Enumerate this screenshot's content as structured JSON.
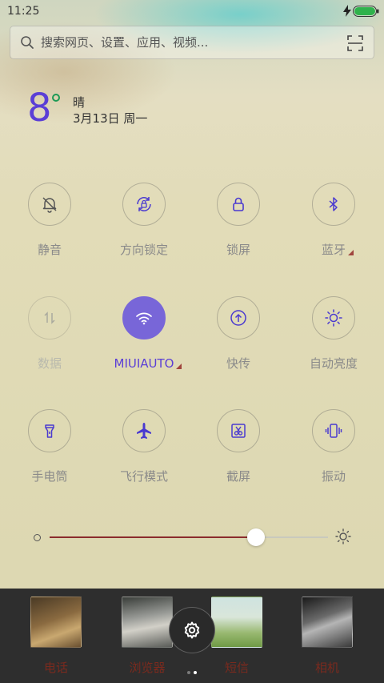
{
  "status_bar": {
    "time": "11:25"
  },
  "search": {
    "placeholder": "搜索网页、设置、应用、视频..."
  },
  "weather": {
    "temperature": "8",
    "condition": "晴",
    "date": "3月13日 周一"
  },
  "toggles": [
    {
      "label": "静音",
      "icon": "bell-off-icon",
      "state": "off"
    },
    {
      "label": "方向锁定",
      "icon": "rotation-lock-icon",
      "state": "off"
    },
    {
      "label": "锁屏",
      "icon": "lock-icon",
      "state": "off"
    },
    {
      "label": "蓝牙",
      "icon": "bluetooth-icon",
      "state": "off",
      "has_more": true
    },
    {
      "label": "数据",
      "icon": "mobile-data-icon",
      "state": "disabled"
    },
    {
      "label": "MIUIAUTO",
      "icon": "wifi-icon",
      "state": "on",
      "has_more": true
    },
    {
      "label": "快传",
      "icon": "transfer-icon",
      "state": "off"
    },
    {
      "label": "自动亮度",
      "icon": "sun-icon",
      "state": "off"
    },
    {
      "label": "手电筒",
      "icon": "flashlight-icon",
      "state": "off"
    },
    {
      "label": "飞行模式",
      "icon": "airplane-icon",
      "state": "off"
    },
    {
      "label": "截屏",
      "icon": "screenshot-icon",
      "state": "off"
    },
    {
      "label": "振动",
      "icon": "vibrate-icon",
      "state": "off"
    }
  ],
  "brightness": {
    "level": 0.74
  },
  "dock": {
    "apps": [
      {
        "label": "电话"
      },
      {
        "label": "浏览器"
      },
      {
        "label": "短信"
      },
      {
        "label": "相机"
      }
    ],
    "page_dots": 2,
    "current_page": 1
  },
  "colors": {
    "accent": "#5b3fd6",
    "toggle_on": "#7866d8",
    "slider_fill": "#8b2c2c",
    "dock_label": "#7a2a1e",
    "dock_bg": "#2e2e2e",
    "battery": "#2fb24c"
  }
}
